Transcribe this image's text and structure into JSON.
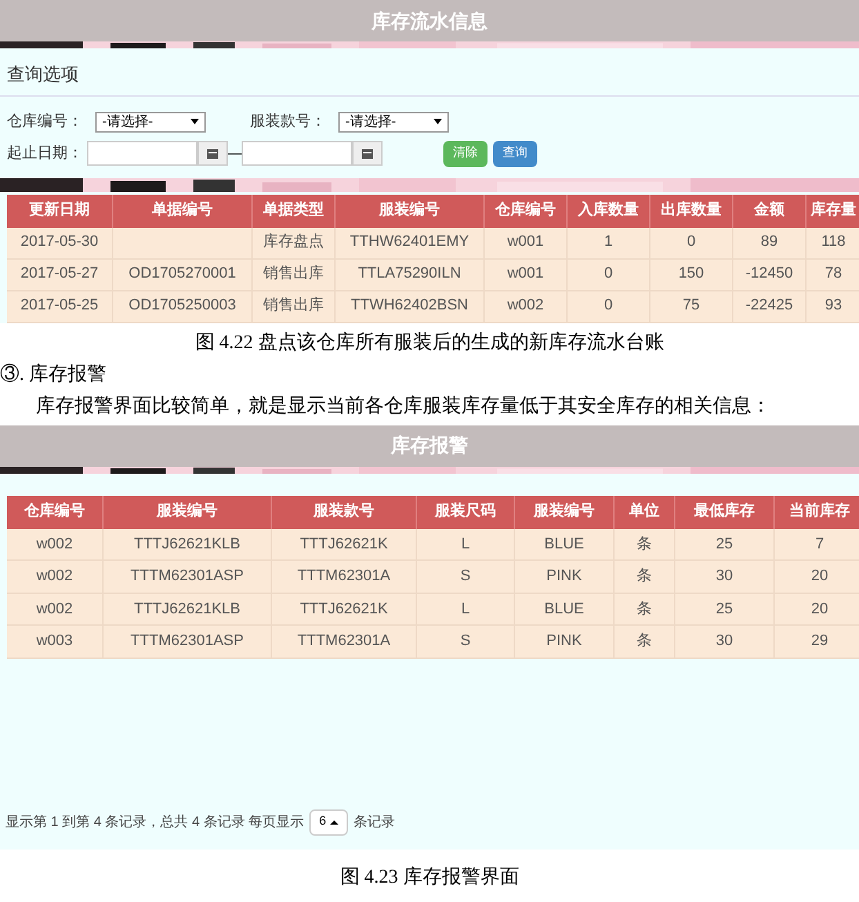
{
  "ledger_window": {
    "title": "库存流水信息",
    "query_panel": {
      "title": "查询选项",
      "warehouse_select": {
        "label": "仓库编号：",
        "value": "-请选择-"
      },
      "style_select": {
        "label": "服装款号：",
        "value": "-请选择-"
      },
      "date_range": {
        "label": "起止日期：",
        "separator": "—"
      },
      "buttons": [
        {
          "label": "清除",
          "kind": "clear"
        },
        {
          "label": "查询",
          "kind": "search"
        }
      ]
    },
    "table": {
      "columns": [
        "更新日期",
        "单据编号",
        "单据类型",
        "服装编号",
        "仓库编号",
        "入库数量",
        "出库数量",
        "金额",
        "库存量"
      ],
      "rows": [
        [
          "2017-05-30",
          "",
          "库存盘点",
          "TTHW62401EMY",
          "w001",
          "1",
          "0",
          "89",
          "118"
        ],
        [
          "2017-05-27",
          "OD1705270001",
          "销售出库",
          "TTLA75290ILN",
          "w001",
          "0",
          "150",
          "-12450",
          "78"
        ],
        [
          "2017-05-25",
          "OD1705250003",
          "销售出库",
          "TTWH62402BSN",
          "w002",
          "0",
          "75",
          "-22425",
          "93"
        ]
      ]
    }
  },
  "caption_1": "图 4.22 盘点该仓库所有服装后的生成的新库存流水台账",
  "section_heading": "③. 库存报警",
  "paragraph": "库存报警界面比较简单，就是显示当前各仓库服装库存量低于其安全库存的相关信息：",
  "alert_window": {
    "title": "库存报警",
    "table": {
      "columns": [
        "仓库编号",
        "服装编号",
        "服装款号",
        "服装尺码",
        "服装编号",
        "单位",
        "最低库存",
        "当前库存"
      ],
      "rows": [
        [
          "w002",
          "TTTJ62621KLB",
          "TTTJ62621K",
          "L",
          "BLUE",
          "条",
          "25",
          "7"
        ],
        [
          "w002",
          "TTTM62301ASP",
          "TTTM62301A",
          "S",
          "PINK",
          "条",
          "30",
          "20"
        ],
        [
          "w002",
          "TTTJ62621KLB",
          "TTTJ62621K",
          "L",
          "BLUE",
          "条",
          "25",
          "20"
        ],
        [
          "w003",
          "TTTM62301ASP",
          "TTTM62301A",
          "S",
          "PINK",
          "条",
          "30",
          "29"
        ]
      ]
    },
    "pagination": {
      "summary": "显示第 1 到第 4 条记录，总共 4 条记录 每页显示",
      "page_size": "6",
      "suffix": "条记录"
    }
  },
  "caption_2": "图 4.23 库存报警界面"
}
